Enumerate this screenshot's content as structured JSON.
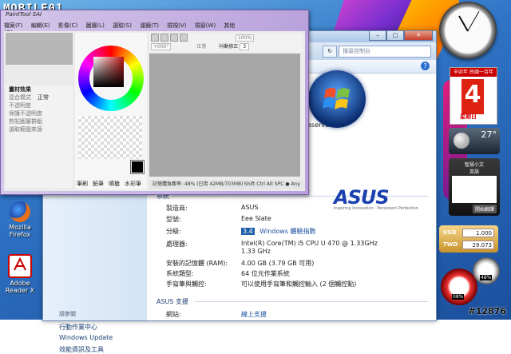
{
  "watermark": {
    "logo_text": "MOBILE01"
  },
  "desktop_icons": [
    {
      "label": "Mozilla Firefox"
    },
    {
      "label": "Adobe Reader X"
    }
  ],
  "sai": {
    "title": "PaintTool SAI",
    "menu": [
      "檔案(F)",
      "編輯(E)",
      "影像(C)",
      "圖層(L)",
      "選取(S)",
      "濾鏡(T)",
      "檢視(V)",
      "視窗(W)",
      "其他(O)"
    ],
    "left_panel": {
      "section": "畫材效果",
      "rows": [
        "混合模式",
        "不透明度",
        "保護不透明度",
        "剪貼圖層群組",
        "選取範圍來源"
      ],
      "blend_value": "正常"
    },
    "toolbar": {
      "opacity": "100%",
      "zoom": "+000°",
      "mode": "正常",
      "stabilizer_label": "抖動修正",
      "stabilizer_value": "3"
    },
    "tabs": [
      "筆刷",
      "鉛筆",
      "噴槍",
      "水彩筆"
    ],
    "status": "記憶體負載率: 48% (已用 42MB/703MB)",
    "status_keys": "Shift Ctrl Alt SPC ● Any"
  },
  "explorer": {
    "search_placeholder": "搜尋控制台",
    "rights": "reserved.",
    "section_system": "系統",
    "system_rows": [
      {
        "k": "製造商:",
        "v": "ASUS"
      },
      {
        "k": "型號:",
        "v": "Eee Slate"
      },
      {
        "k": "分級:",
        "v": "Windows 體驗指數"
      },
      {
        "k": "處理器:",
        "v": "Intel(R) Core(TM) i5 CPU      U 470  @ 1.33GHz"
      },
      {
        "k": "",
        "v": "1.33 GHz"
      },
      {
        "k": "安裝的記憶體 (RAM):",
        "v": "4.00 GB (3.79 GB 可用)"
      },
      {
        "k": "系統類型:",
        "v": "64 位元作業系統"
      },
      {
        "k": "手寫筆與觸控:",
        "v": "可以使用手寫筆和觸控輸入 (2 個觸控點)"
      }
    ],
    "rating_value": "3.4",
    "section_support": "ASUS 支援",
    "website_label": "網站:",
    "website_link": "線上支援",
    "asus_logo": "ASUS",
    "asus_tagline": "Inspiring Innovation · Persistent Perfection",
    "left_nav": {
      "see_also": "請參閱",
      "links": [
        "行動作業中心",
        "Windows Update",
        "效能資訊及工具"
      ]
    }
  },
  "gadgets": {
    "calendar_top": "辛卯年 民國一百年",
    "calendar_day": "4",
    "calendar_weekday": "星期日",
    "weather_temp": "27°",
    "gadget3_title": "智慧小文",
    "gadget3_sub": "英語",
    "gadget3_button": "開始翻譯",
    "currency": [
      {
        "label": "USD",
        "value": "1.000"
      },
      {
        "label": "TWD",
        "value": "29.073"
      }
    ],
    "meter_values": [
      "08%",
      "48%"
    ]
  },
  "post_id": "#12876"
}
